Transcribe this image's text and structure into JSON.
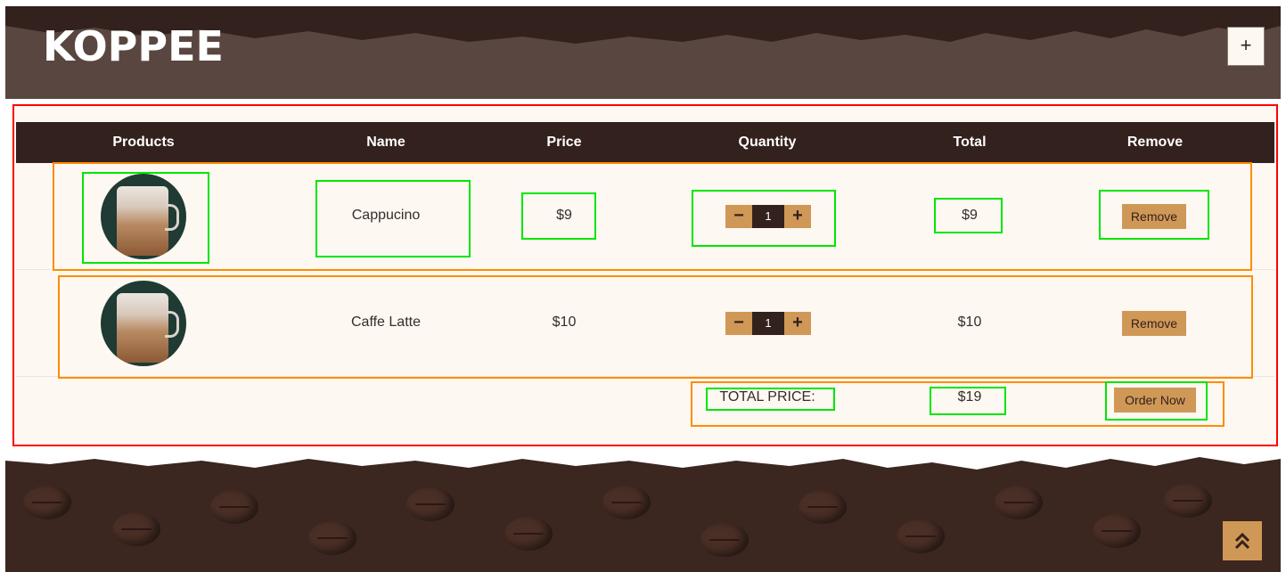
{
  "brand": {
    "name": "KOPPEE"
  },
  "header": {
    "menu_icon": "+"
  },
  "table": {
    "headers": [
      "Products",
      "Name",
      "Price",
      "Quantity",
      "Total",
      "Remove"
    ],
    "rows": [
      {
        "image_icon": "cappuccino-image",
        "name": "Cappucino",
        "price": "$9",
        "quantity": "1",
        "total": "$9",
        "remove_label": "Remove"
      },
      {
        "image_icon": "caffe-latte-image",
        "name": "Caffe Latte",
        "price": "$10",
        "quantity": "1",
        "total": "$10",
        "remove_label": "Remove"
      }
    ],
    "qty_minus": "−",
    "qty_plus": "+"
  },
  "summary": {
    "label": "TOTAL PRICE:",
    "value": "$19",
    "order_label": "Order Now"
  },
  "footer": {
    "back_to_top_icon": "double-chevron-up-icon"
  },
  "colors": {
    "dark": "#33211d",
    "accent": "#d09856",
    "cream": "#fdf8f2",
    "header_bg": "#5a4640"
  }
}
